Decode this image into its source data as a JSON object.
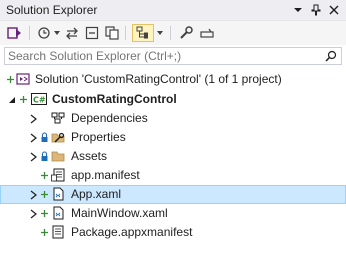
{
  "window": {
    "title": "Solution Explorer"
  },
  "search": {
    "placeholder": "Search Solution Explorer (Ctrl+;)"
  },
  "tree": {
    "solution": "Solution 'CustomRatingControl' (1 of 1 project)",
    "project": "CustomRatingControl",
    "items": [
      {
        "label": "Dependencies"
      },
      {
        "label": "Properties"
      },
      {
        "label": "Assets"
      },
      {
        "label": "app.manifest"
      },
      {
        "label": "App.xaml"
      },
      {
        "label": "MainWindow.xaml"
      },
      {
        "label": "Package.appxmanifest"
      }
    ]
  },
  "colors": {
    "accent": "#68217a",
    "selection": "#cce8ff",
    "added": "#388a34",
    "lock": "#1e6dbb"
  }
}
